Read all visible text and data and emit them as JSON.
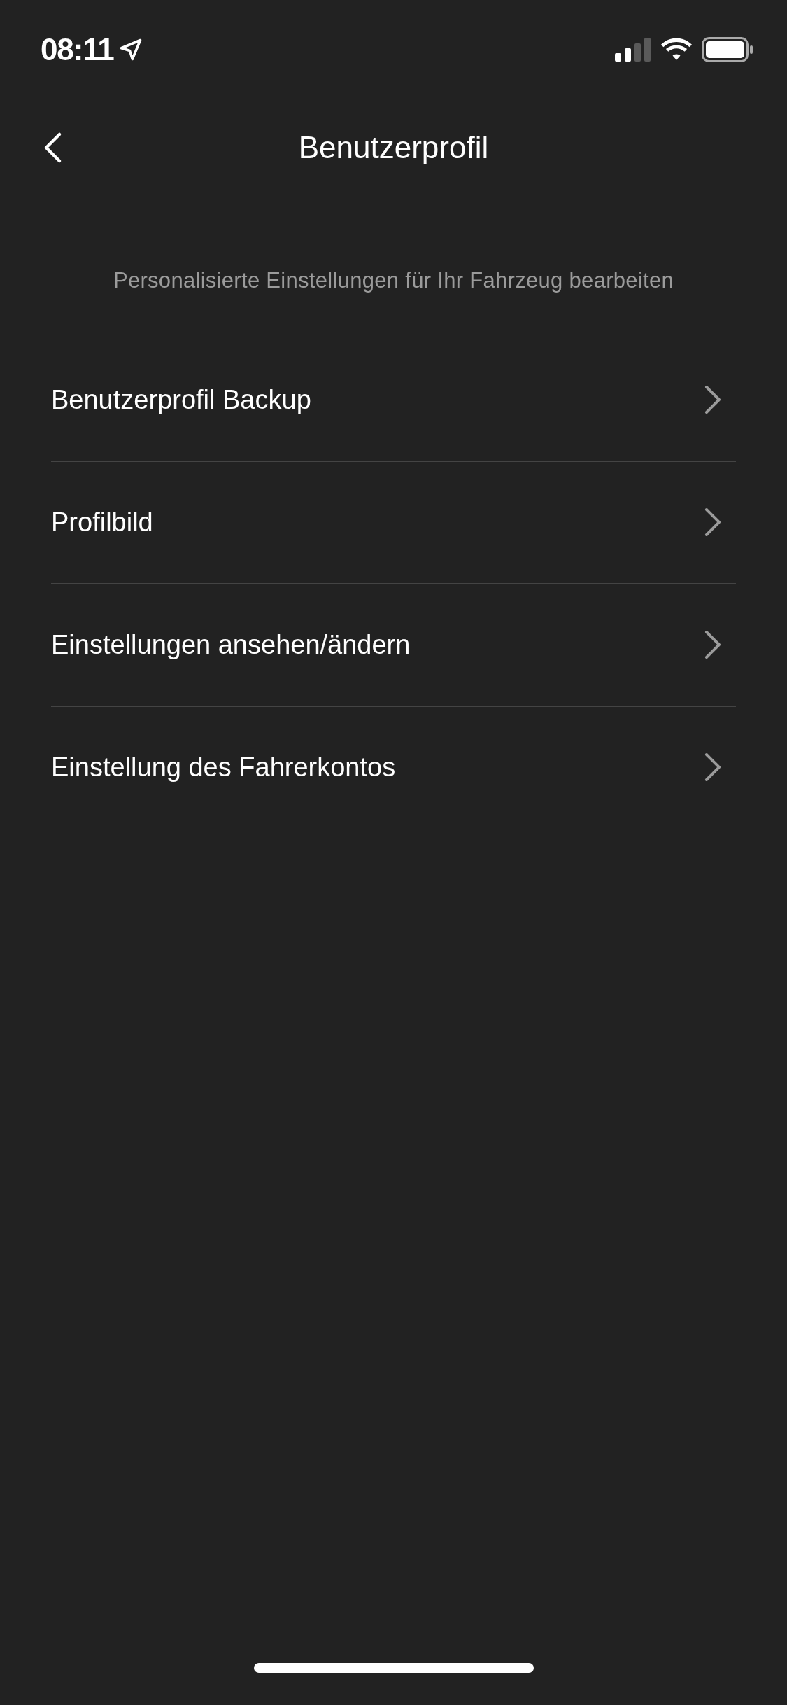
{
  "status_bar": {
    "time": "08:11"
  },
  "header": {
    "title": "Benutzerprofil"
  },
  "subtitle": "Personalisierte Einstellungen für Ihr Fahrzeug bearbeiten",
  "menu_items": [
    {
      "label": "Benutzerprofil Backup"
    },
    {
      "label": "Profilbild"
    },
    {
      "label": "Einstellungen ansehen/ändern"
    },
    {
      "label": "Einstellung des Fahrerkontos"
    }
  ]
}
